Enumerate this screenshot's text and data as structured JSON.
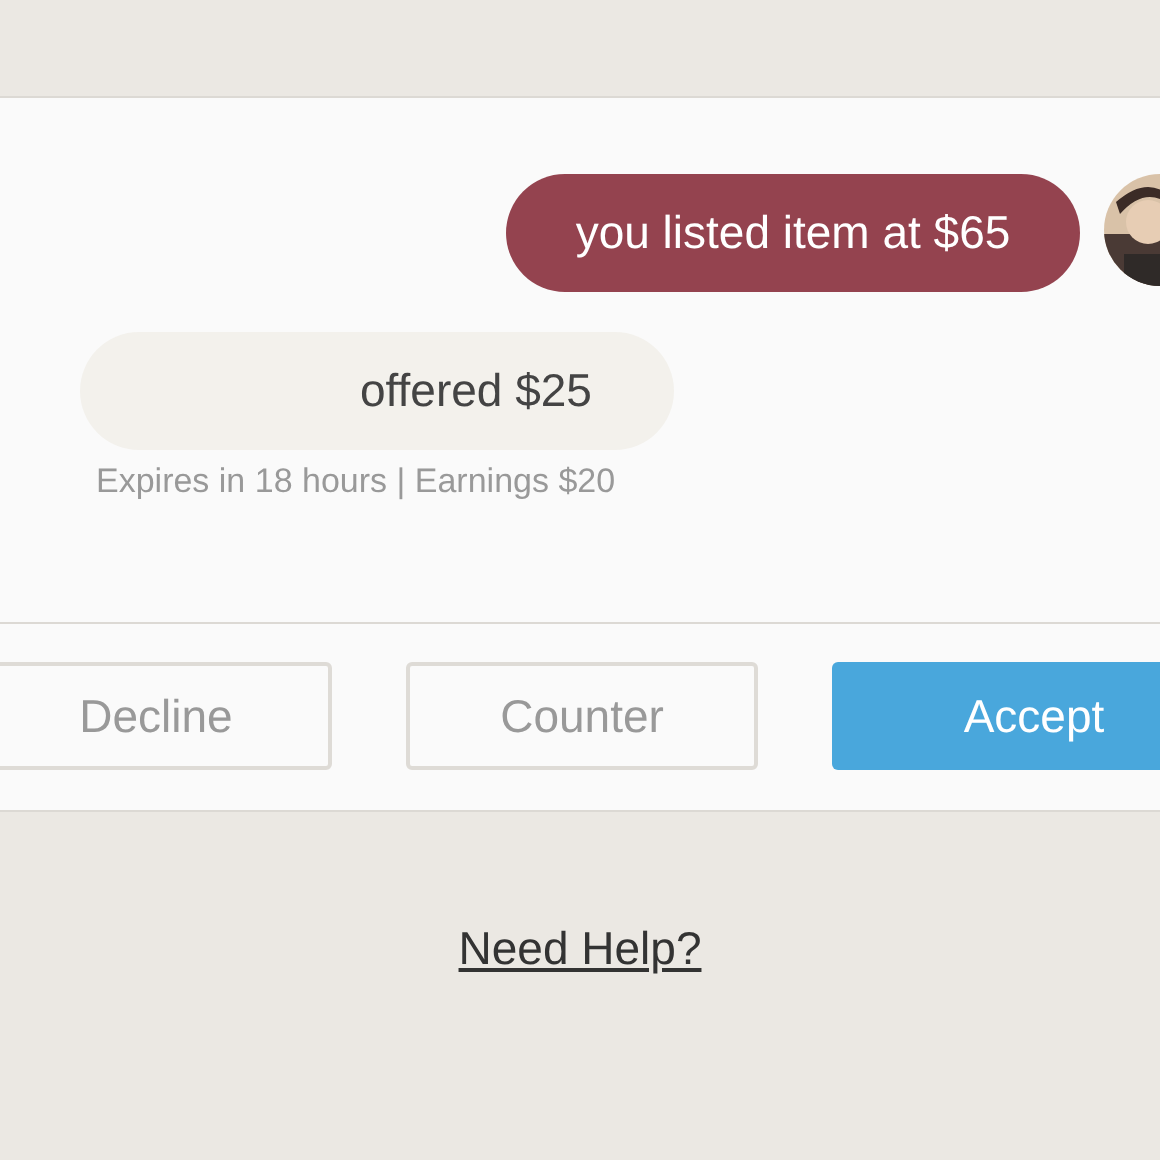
{
  "messages": [
    {
      "kind": "seller",
      "text": "you listed item at $65"
    },
    {
      "kind": "buyer",
      "text": "offered $25",
      "meta": "Expires in 18 hours | Earnings $20"
    }
  ],
  "buttons": [
    {
      "label": "Decline",
      "kind": "outline"
    },
    {
      "label": "Counter",
      "kind": "outline"
    },
    {
      "label": "Accept",
      "kind": "primary"
    }
  ],
  "help_link": "Need Help?"
}
